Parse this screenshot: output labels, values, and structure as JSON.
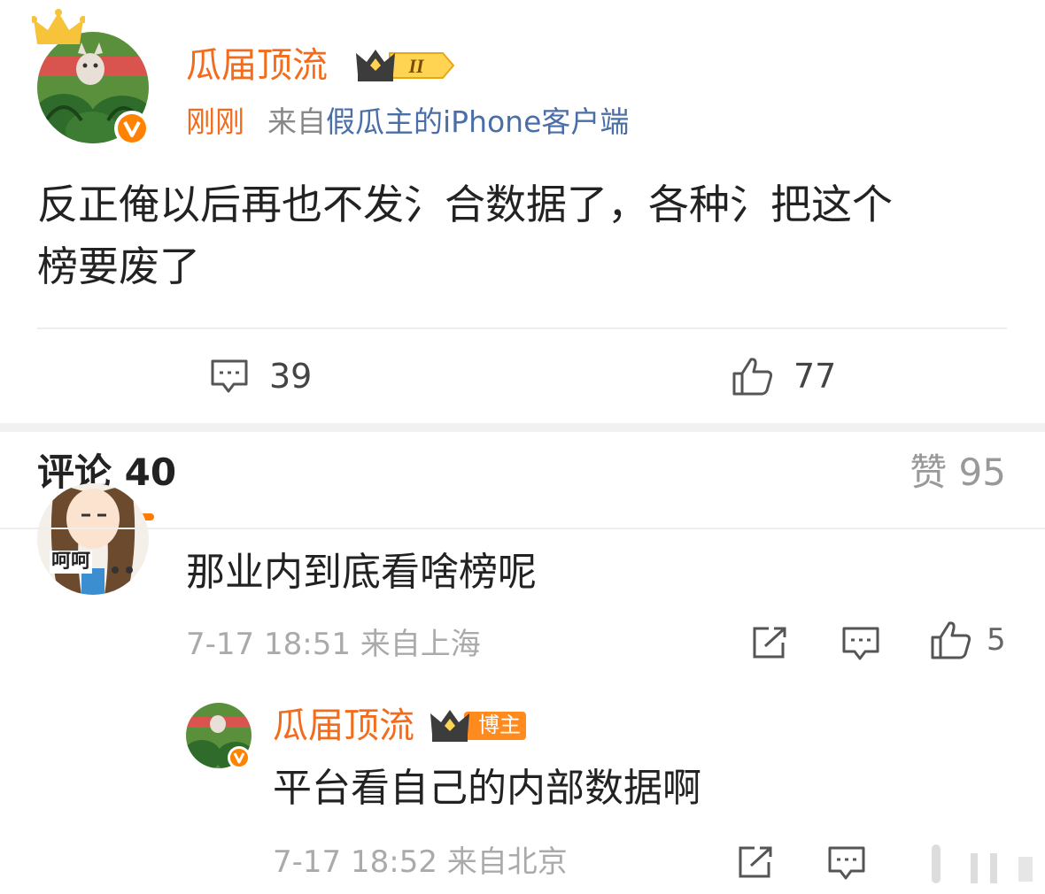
{
  "post": {
    "author": "瓜届顶流",
    "level_badge": "II",
    "time": "刚刚",
    "source_prefix": "来自",
    "source_device": "假瓜主的iPhone客户端",
    "body_line1": "反正俺以后再也不发氵合数据了，各种氵把这个",
    "body_line2": "榜要废了",
    "comment_count": "39",
    "like_count": "77"
  },
  "tabs": {
    "comments_label": "评论 40",
    "likes_label": "赞 95"
  },
  "comments": [
    {
      "avatar_text": "呵呵",
      "text": "那业内到底看啥榜呢",
      "meta": "7-17 18:51 来自上海",
      "like_count": "5"
    }
  ],
  "reply": {
    "author": "瓜届顶流",
    "badge": "博主",
    "text": "平台看自己的内部数据啊",
    "meta": "7-17 18:52 来自北京"
  },
  "colors": {
    "accent": "#f36b1c",
    "link": "#4a6ea8",
    "muted": "#aaaaaa",
    "tab_underline": "#ff7a00"
  }
}
